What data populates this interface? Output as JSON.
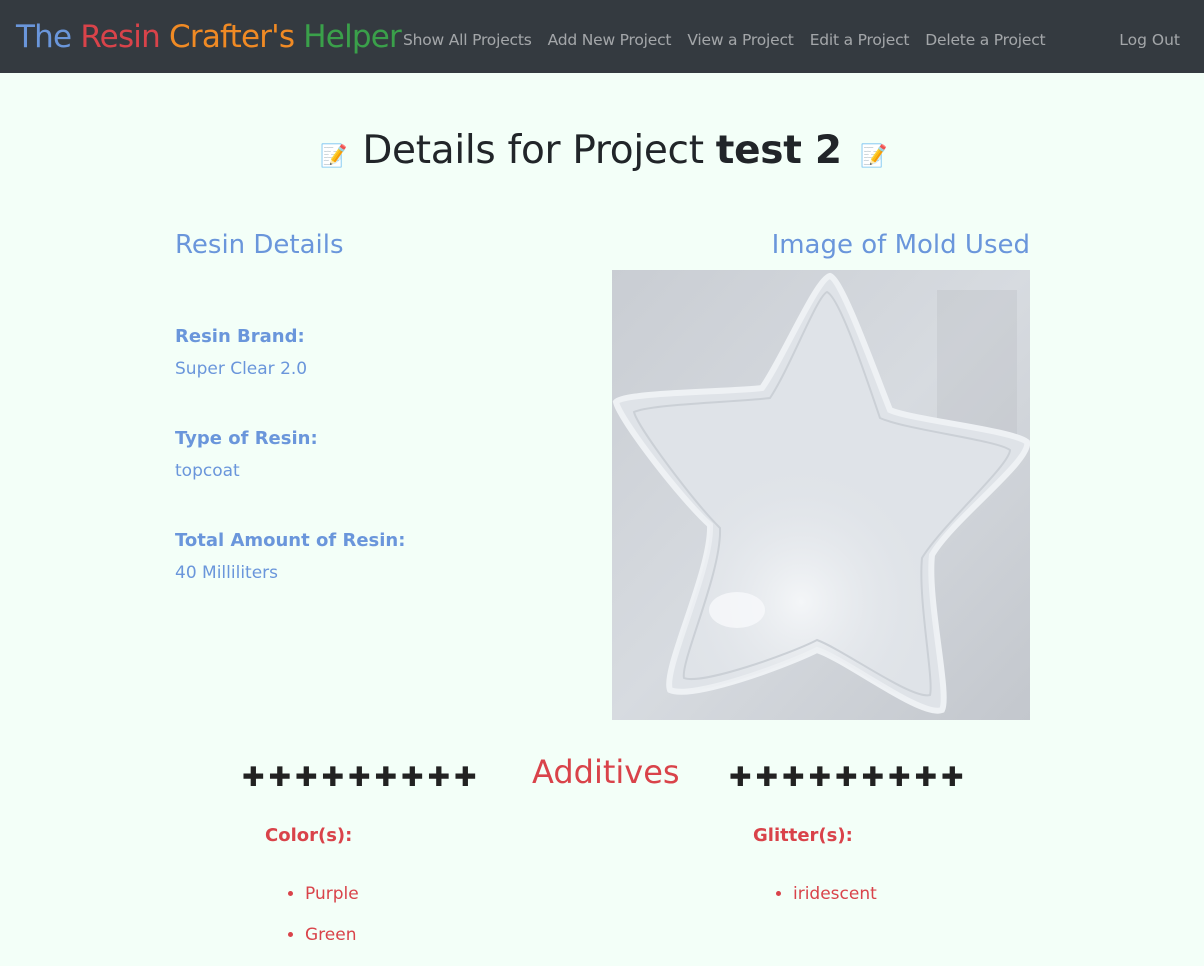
{
  "navbar": {
    "brand": {
      "word1": "The",
      "word2": "Resin",
      "word3": "Crafter's",
      "word4": "Helper"
    },
    "brand_colors": {
      "word1": "#6a96db",
      "word2": "#d9434a",
      "word3": "#f08a24",
      "word4": "#3aa04a"
    },
    "links": [
      "Show All Projects",
      "Add New Project",
      "View a Project",
      "Edit a Project",
      "Delete a Project"
    ],
    "logout": "Log Out"
  },
  "page": {
    "title_prefix": "Details for Project",
    "project_name": "test 2",
    "memo_icon": "📝"
  },
  "resin": {
    "heading": "Resin Details",
    "brand_label": "Resin Brand:",
    "brand_value": "Super Clear 2.0",
    "type_label": "Type of Resin:",
    "type_value": "topcoat",
    "amount_label": "Total Amount of Resin:",
    "amount_value": "40 Milliliters"
  },
  "mold": {
    "heading": "Image of Mold Used",
    "image_subject": "star-shaped silicone mold"
  },
  "additives": {
    "heading": "Additives",
    "cross_glyph": "✚",
    "colors_label": "Color(s):",
    "colors": [
      "Purple",
      "Green"
    ],
    "glitters_label": "Glitter(s):",
    "glitters": [
      "iridescent"
    ]
  },
  "theme": {
    "accent_blue": "#6a96db",
    "accent_red": "#d9434a",
    "navbar_bg": "#343a40",
    "page_bg": "#f3fff8"
  }
}
